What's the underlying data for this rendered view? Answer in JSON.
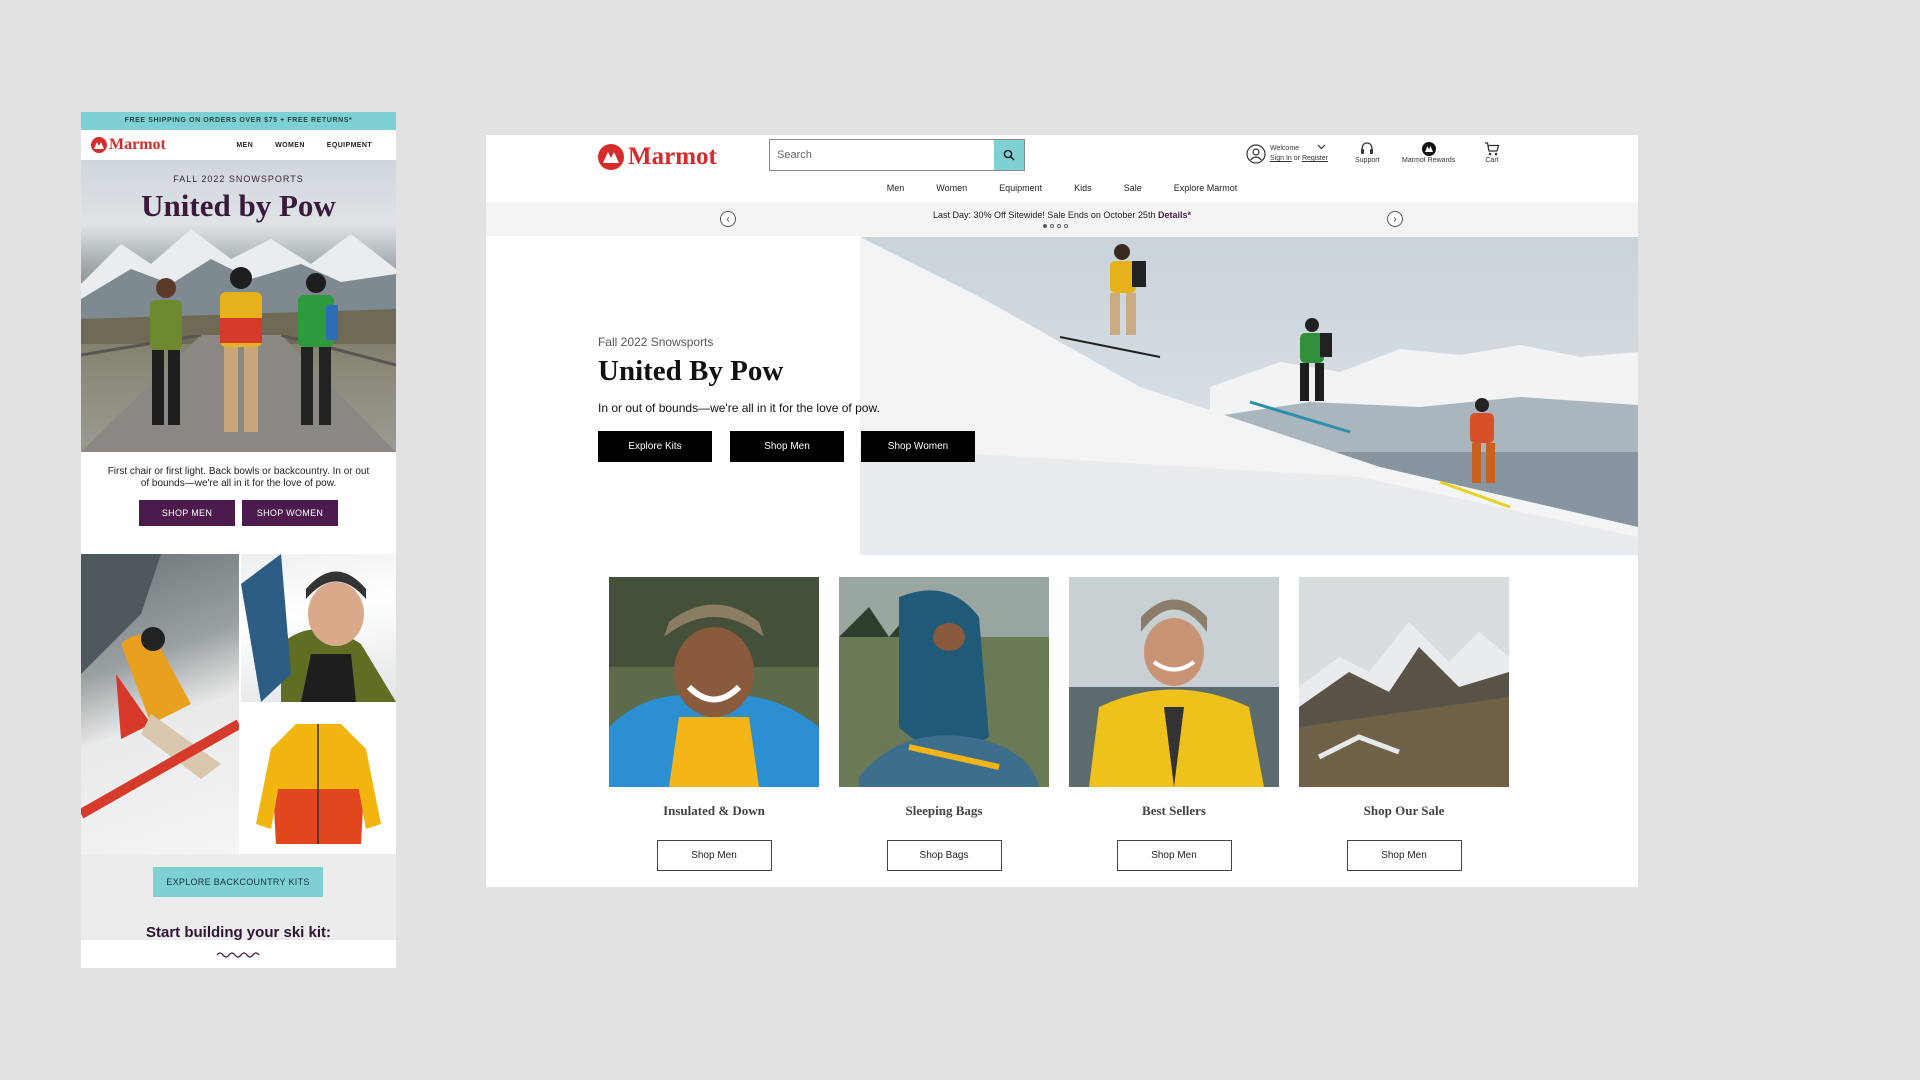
{
  "email": {
    "top_bar": "FREE SHIPPING ON ORDERS OVER $75 + FREE RETURNS*",
    "brand": "Marmot",
    "nav": [
      "MEN",
      "WOMEN",
      "EQUIPMENT"
    ],
    "hero_kicker": "FALL 2022 SNOWSPORTS",
    "hero_title": "United by Pow",
    "body_copy": "First chair or first light. Back bowls or backcountry. In or out of bounds—we're all in it for the love of pow.",
    "btn_shop_men": "SHOP MEN",
    "btn_shop_women": "SHOP WOMEN",
    "btn_explore_kits": "EXPLORE BACKCOUNTRY KITS",
    "section_heading": "Start building your ski kit:"
  },
  "site": {
    "brand": "Marmot",
    "search_placeholder": "Search",
    "welcome": "Welcome",
    "sign_in": "Sign In",
    "or": "or",
    "register": "Register",
    "support": "Support",
    "rewards": "Marmot Rewards",
    "cart": "Cart",
    "nav": [
      "Men",
      "Women",
      "Equipment",
      "Kids",
      "Sale",
      "Explore Marmot"
    ],
    "promo_text": "Last Day: 30% Off Sitewide! Sale Ends on October 25th",
    "promo_link": "Details*",
    "hero_kicker": "Fall 2022 Snowsports",
    "hero_title": "United By Pow",
    "hero_sub": "In or out of bounds—we're all in it for the love of pow.",
    "hero_buttons": [
      "Explore Kits",
      "Shop Men",
      "Shop Women"
    ],
    "cards": [
      {
        "label": "Insulated & Down",
        "button": "Shop Men"
      },
      {
        "label": "Sleeping Bags",
        "button": "Shop Bags"
      },
      {
        "label": "Best Sellers",
        "button": "Shop Men"
      },
      {
        "label": "Shop Our Sale",
        "button": "Shop Men"
      }
    ]
  },
  "colors": {
    "brand_red": "#d62b2b",
    "teal": "#7fd0d3",
    "plum": "#4c1a4d"
  }
}
